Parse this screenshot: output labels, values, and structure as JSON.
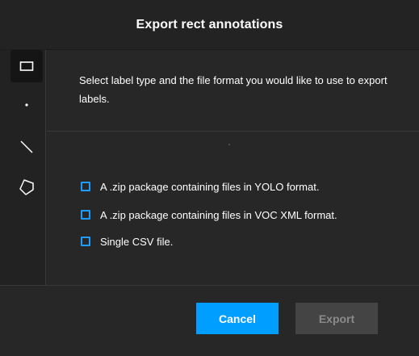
{
  "modal": {
    "title": "Export rect annotations",
    "description": "Select label type and the file format you would like to use to export labels."
  },
  "tools": [
    {
      "name": "rect-tool",
      "icon": "rectangle-icon",
      "active": true
    },
    {
      "name": "point-tool",
      "icon": "point-icon",
      "active": false
    },
    {
      "name": "line-tool",
      "icon": "line-icon",
      "active": false
    },
    {
      "name": "polygon-tool",
      "icon": "polygon-icon",
      "active": false
    }
  ],
  "options": [
    {
      "label": "A .zip package containing files in YOLO format.",
      "checked": false
    },
    {
      "label": "A .zip package containing files in VOC XML format.",
      "checked": false
    },
    {
      "label": "Single CSV file.",
      "checked": false
    }
  ],
  "buttons": {
    "cancel_label": "Cancel",
    "export_label": "Export"
  },
  "colors": {
    "accent": "#009eff",
    "checkbox_border": "#1f9cff",
    "modal_bg": "#272727",
    "disabled_button": "#444444"
  }
}
